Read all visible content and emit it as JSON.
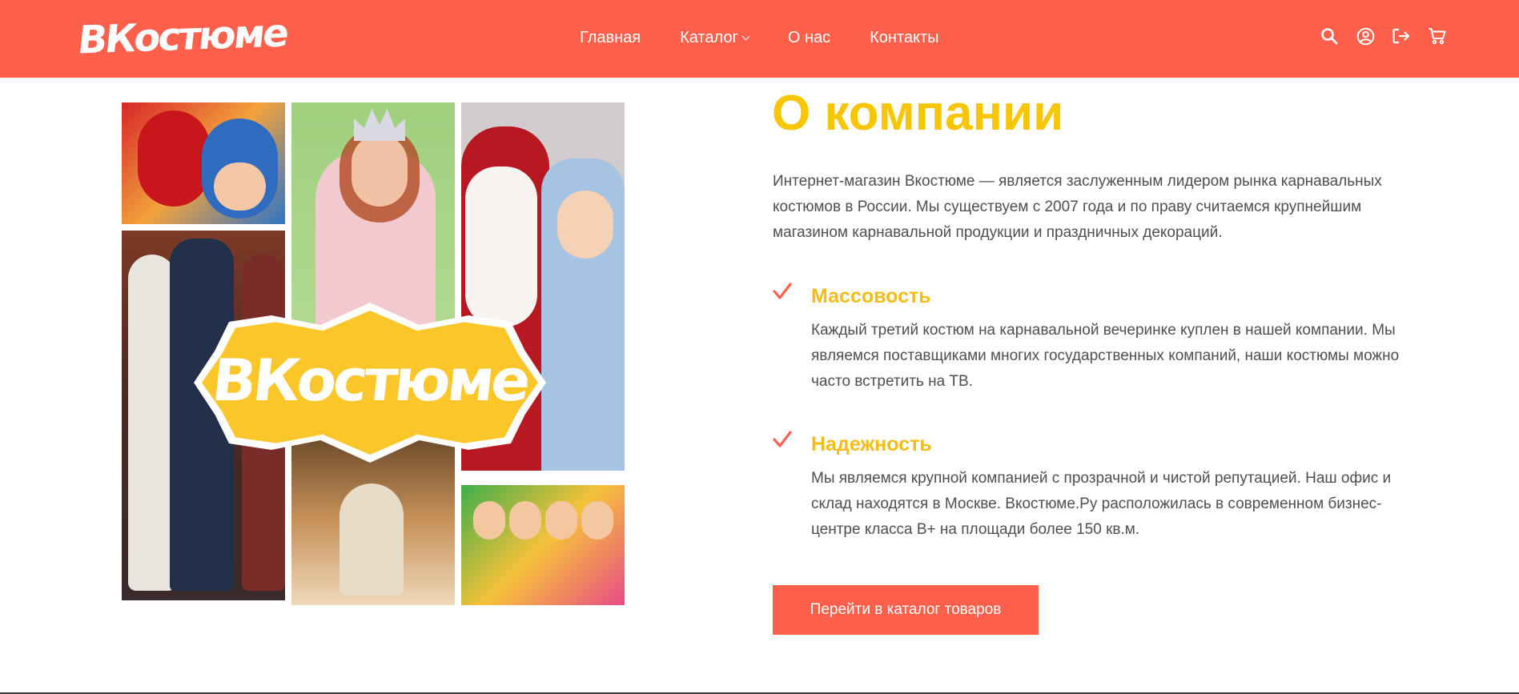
{
  "brand": {
    "logo_text": "ВКостюме",
    "accent_color": "#ff604c",
    "title_color": "#f8c600"
  },
  "nav": {
    "items": [
      {
        "label": "Главная"
      },
      {
        "label": "Каталог",
        "has_dropdown": true
      },
      {
        "label": "О нас"
      },
      {
        "label": "Контакты"
      }
    ]
  },
  "header_icons": [
    "search-icon",
    "account-icon",
    "logout-icon",
    "cart-icon"
  ],
  "collage": {
    "badge_text": "ВКостюме"
  },
  "about": {
    "title": "О компании",
    "intro": "Интернет-магазин Вкостюме — является заслуженным лидером рынка карнавальных костюмов в России. Мы существуем с 2007 года и по праву считаемся крупнейшим магазином карнавальной продукции и праздничных декораций.",
    "features": [
      {
        "title": "Массовость",
        "text": "Каждый третий костюм на карнавальной вечеринке куплен в нашей компании. Мы являемся поставщиками многих государственных компаний, наши костюмы можно часто встретить на ТВ."
      },
      {
        "title": "Надежность",
        "text": "Мы являемся крупной компанией с прозрачной и чистой репутацией. Наш офис и склад находятся в Москве. Вкостюме.Ру расположилась в современном бизнес-центре класса В+ на площади более 150 кв.м."
      }
    ],
    "cta_label": "Перейти в каталог товаров"
  }
}
